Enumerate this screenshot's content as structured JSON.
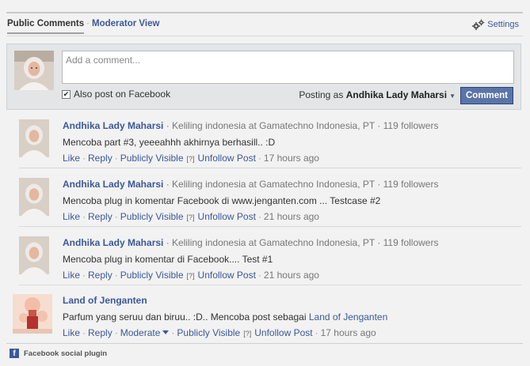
{
  "tabs": {
    "public": "Public Comments",
    "sep": "·",
    "moderator": "Moderator View"
  },
  "settings": {
    "label": "Settings",
    "icon": "gears-icon"
  },
  "composer": {
    "placeholder": "Add a comment...",
    "also_post": "Also post on Facebook",
    "also_post_checked": true,
    "posting_as_prefix": "Posting as",
    "posting_as_name": "Andhika Lady Maharsi",
    "button": "Comment"
  },
  "comments": [
    {
      "name": "Andhika Lady Maharsi",
      "meta": " · Keliling indonesia at Gamatechno Indonesia, PT · 119 followers",
      "text": "Mencoba part #3, yeeeahhh akhirnya berhasill.. :D",
      "actions": {
        "like": "Like",
        "reply": "Reply",
        "visible": "Publicly Visible",
        "q": "[?]",
        "unfollow": "Unfollow Post",
        "time": "17 hours ago"
      }
    },
    {
      "name": "Andhika Lady Maharsi",
      "meta": " · Keliling indonesia at Gamatechno Indonesia, PT · 119 followers",
      "text": "Mencoba plug in komentar Facebook di www.jenganten.com ... Testcase #2",
      "actions": {
        "like": "Like",
        "reply": "Reply",
        "visible": "Publicly Visible",
        "q": "[?]",
        "unfollow": "Unfollow Post",
        "time": "21 hours ago"
      }
    },
    {
      "name": "Andhika Lady Maharsi",
      "meta": " · Keliling indonesia at Gamatechno Indonesia, PT · 119 followers",
      "text": "Mencoba plug in komentar di Facebook.... Test #1",
      "actions": {
        "like": "Like",
        "reply": "Reply",
        "visible": "Publicly Visible",
        "q": "[?]",
        "unfollow": "Unfollow Post",
        "time": "21 hours ago"
      }
    },
    {
      "name": "Land of Jenganten",
      "text_prefix": "Parfum yang seruu dan biruu.. :D.. Mencoba post sebagai ",
      "text_link": "Land of Jenganten",
      "actions": {
        "like": "Like",
        "reply": "Reply",
        "moderate": "Moderate",
        "visible": "Publicly Visible",
        "q": "[?]",
        "unfollow": "Unfollow Post",
        "time": "17 hours ago"
      }
    }
  ],
  "footer": {
    "label": "Facebook social plugin",
    "icon": "facebook-icon"
  },
  "colors": {
    "link": "#3b5998",
    "button": "#5b74a8",
    "background": "#f2f2f2",
    "composer_bg": "#e4e5e7"
  }
}
